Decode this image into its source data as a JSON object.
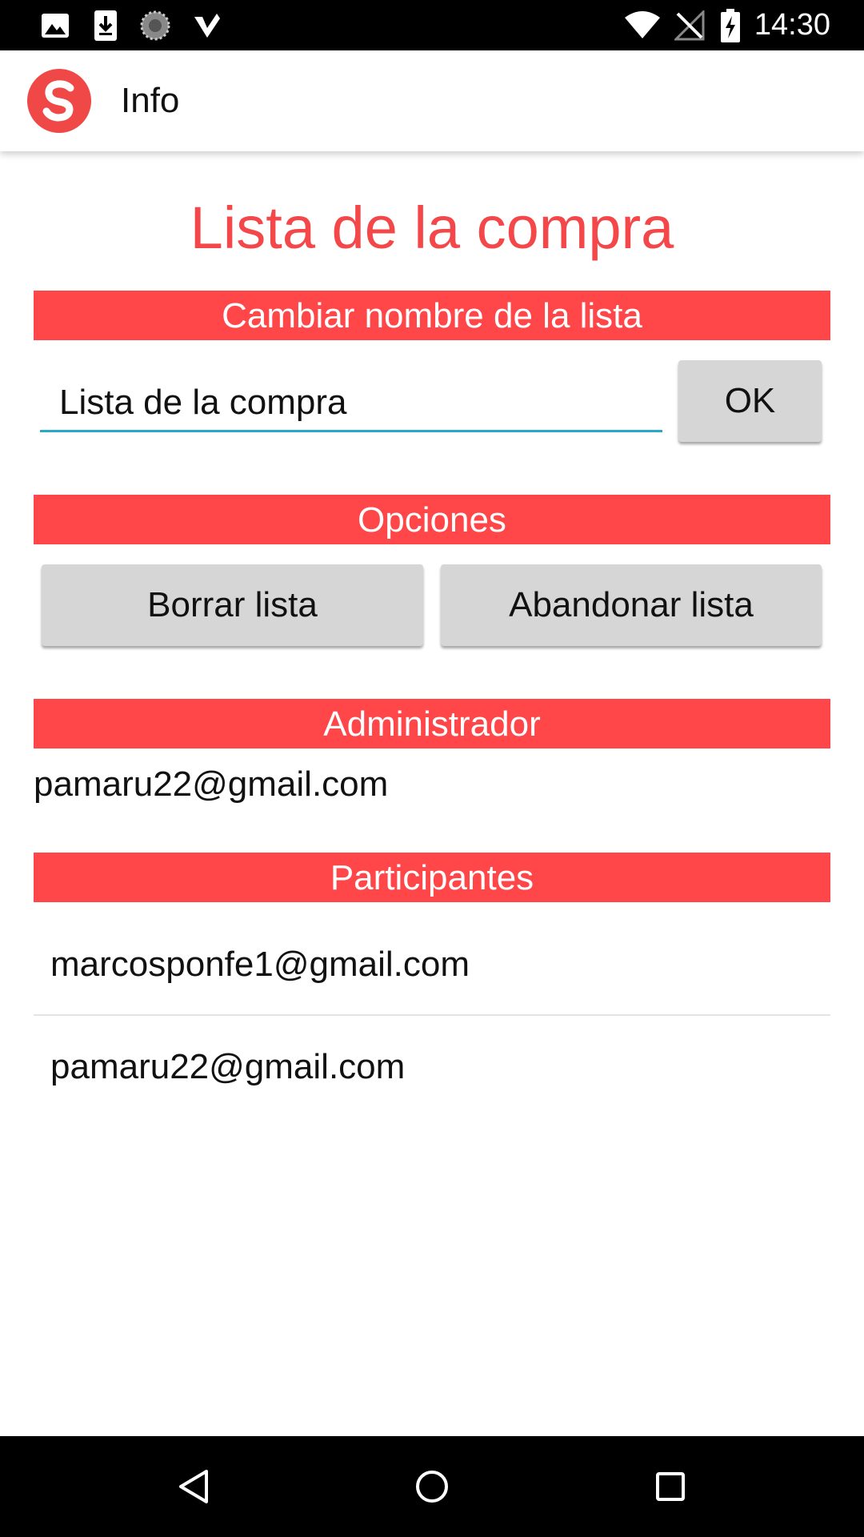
{
  "status_bar": {
    "time": "14:30",
    "icons": [
      "image-icon",
      "download-icon",
      "sync-icon",
      "check-icon",
      "wifi-icon",
      "no-signal-icon",
      "battery-charging-icon"
    ]
  },
  "app_bar": {
    "logo_letter": "S",
    "title": "Info"
  },
  "main": {
    "list_title": "Lista de la compra",
    "rename_section": {
      "header": "Cambiar nombre de la lista",
      "input_value": "Lista de la compra",
      "ok_label": "OK"
    },
    "options_section": {
      "header": "Opciones",
      "delete_label": "Borrar lista",
      "leave_label": "Abandonar lista"
    },
    "admin_section": {
      "header": "Administrador",
      "email": "pamaru22@gmail.com"
    },
    "participants_section": {
      "header": "Participantes",
      "items": [
        {
          "email": "marcosponfe1@gmail.com"
        },
        {
          "email": "pamaru22@gmail.com"
        }
      ]
    }
  },
  "nav_bar": {
    "buttons": [
      "back-icon",
      "home-icon",
      "recents-icon"
    ]
  },
  "colors": {
    "accent": "#ff474a",
    "title": "#f4474a",
    "input_underline": "#2ba8c9",
    "button_bg": "#d6d6d6"
  }
}
